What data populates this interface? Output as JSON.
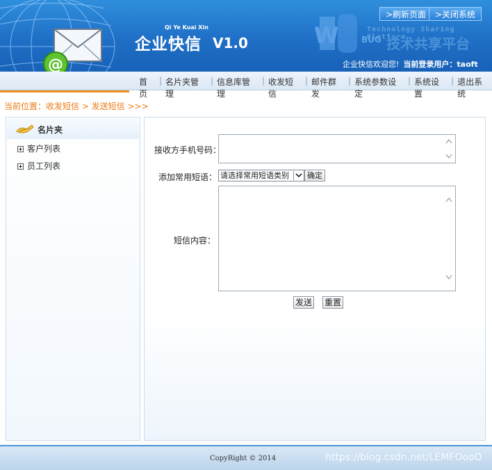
{
  "header": {
    "brand_small": "Qi Ye Kuai Xin",
    "brand_title": "企业快信",
    "brand_version": "V1.0",
    "refresh_label": ">刷新页面",
    "close_label": ">关闭系统",
    "watermark_line1": "Technology Sharing Platform",
    "watermark_bug": "BUG",
    "watermark_cn": "技术共享平台",
    "welcome_text": "企业快信欢迎您!",
    "user_label": "当前登录用户：taoft"
  },
  "nav": {
    "items": [
      "首页",
      "名片夹管理",
      "信息库管理",
      "收发短信",
      "邮件群发",
      "系统参数设定",
      "系统设置",
      "退出系统"
    ]
  },
  "breadcrumb": "当前位置：收发短信 > 发送短信 >>>",
  "sidebar": {
    "title": "名片夹",
    "items": [
      "客户列表",
      "员工列表"
    ]
  },
  "form": {
    "phone_label": "接收方手机号码：",
    "phone_value": "",
    "phrase_label": "添加常用短语：",
    "phrase_select": "请选择常用短语类别",
    "confirm_label": "确定",
    "content_label": "短信内容：",
    "content_value": "",
    "send_label": "发送",
    "reset_label": "重置"
  },
  "footer": {
    "copyright": "CopyRight © 2014",
    "blog": "https://blog.csdn.net/LEMFOooO"
  },
  "colors": {
    "header_blue": "#1f6fc6",
    "accent_orange": "#f08c1c",
    "breadcrumb_orange": "#ee7a14"
  }
}
